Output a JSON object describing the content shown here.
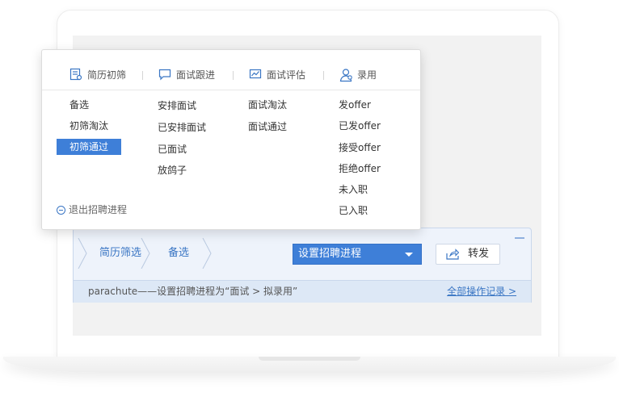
{
  "menu": {
    "tabs": [
      {
        "label": "简历初筛",
        "icon": "resume-icon"
      },
      {
        "label": "面试跟进",
        "icon": "chat-icon"
      },
      {
        "label": "面试评估",
        "icon": "chart-icon"
      },
      {
        "label": "录用",
        "icon": "user-icon"
      }
    ],
    "columns": [
      [
        "备选",
        "初筛淘汰",
        "初筛通过"
      ],
      [
        "安排面试",
        "已安排面试",
        "已面试",
        "放鸽子"
      ],
      [
        "面试淘汰",
        "面试通过"
      ],
      [
        "发offer",
        "已发offer",
        "接受offer",
        "拒绝offer",
        "未入职",
        "已入职"
      ]
    ],
    "selected": "初筛通过",
    "exit_label": "退出招聘进程"
  },
  "panel": {
    "breadcrumb": [
      "简历筛选",
      "备选"
    ],
    "select_label": "设置招聘进程",
    "forward_label": "转发",
    "log_text": "parachute——设置招聘进程为“面试 > 拟录用”",
    "log_link": "全部操作记录 >"
  },
  "colors": {
    "accent": "#3e7fd8",
    "link": "#3a76c4"
  }
}
